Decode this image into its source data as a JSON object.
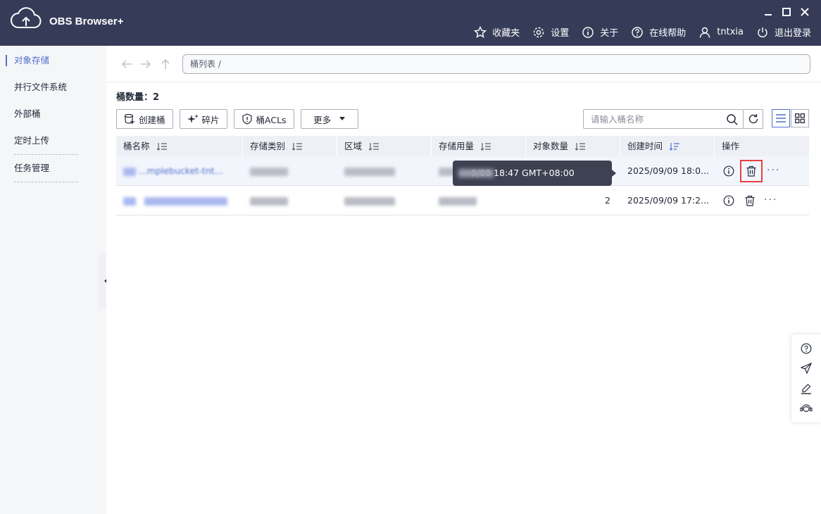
{
  "app": {
    "title": "OBS Browser+"
  },
  "topnav": {
    "favorites": "收藏夹",
    "settings": "设置",
    "about": "关于",
    "help": "在线帮助",
    "user": "tntxia",
    "logout": "退出登录"
  },
  "sidebar": {
    "items": [
      {
        "label": "对象存储"
      },
      {
        "label": "并行文件系统"
      },
      {
        "label": "外部桶"
      },
      {
        "label": "定时上传"
      },
      {
        "label": "任务管理"
      }
    ]
  },
  "address": {
    "path": "桶列表 /"
  },
  "summary": {
    "count_label": "桶数量：",
    "count": "2"
  },
  "toolbar": {
    "create": "创建桶",
    "fragments": "碎片",
    "acls": "桶ACLs",
    "more": "更多"
  },
  "search": {
    "placeholder": "请输入桶名称"
  },
  "table": {
    "headers": [
      "桶名称",
      "存储类别",
      "区域",
      "存储用量",
      "对象数量",
      "创建时间",
      "操作"
    ],
    "rows": [
      {
        "name": "...mplebucket-tnt...",
        "count": "",
        "created": "2025/09/09 18:0..."
      },
      {
        "name": "",
        "count": "2",
        "created": "2025/09/09 17:2..."
      }
    ]
  },
  "tooltip": {
    "text": "9/09 18:47 GMT+08:00"
  },
  "colors": {
    "titlebar": "#363c58",
    "accent": "#526ecc",
    "danger": "#e8403f"
  }
}
